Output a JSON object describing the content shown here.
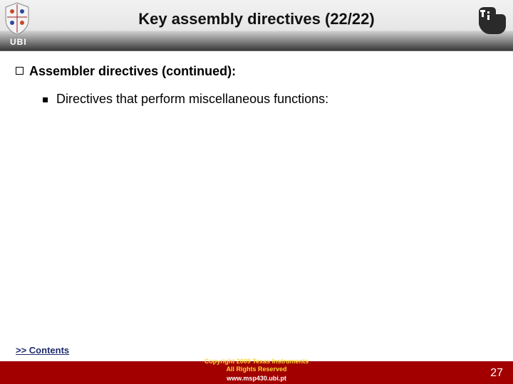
{
  "header": {
    "title": "Key assembly directives (22/22)",
    "ubi_label": "UBI"
  },
  "body": {
    "level1_text": "Assembler directives (continued):",
    "level2_text": "Directives that perform miscellaneous functions:"
  },
  "nav": {
    "contents_link": ">> Contents"
  },
  "footer": {
    "copyright_line1": "Copyright 2009 Texas Instruments",
    "copyright_line2": "All Rights Reserved",
    "site": "www.msp430.ubi.pt",
    "page_number": "27"
  }
}
